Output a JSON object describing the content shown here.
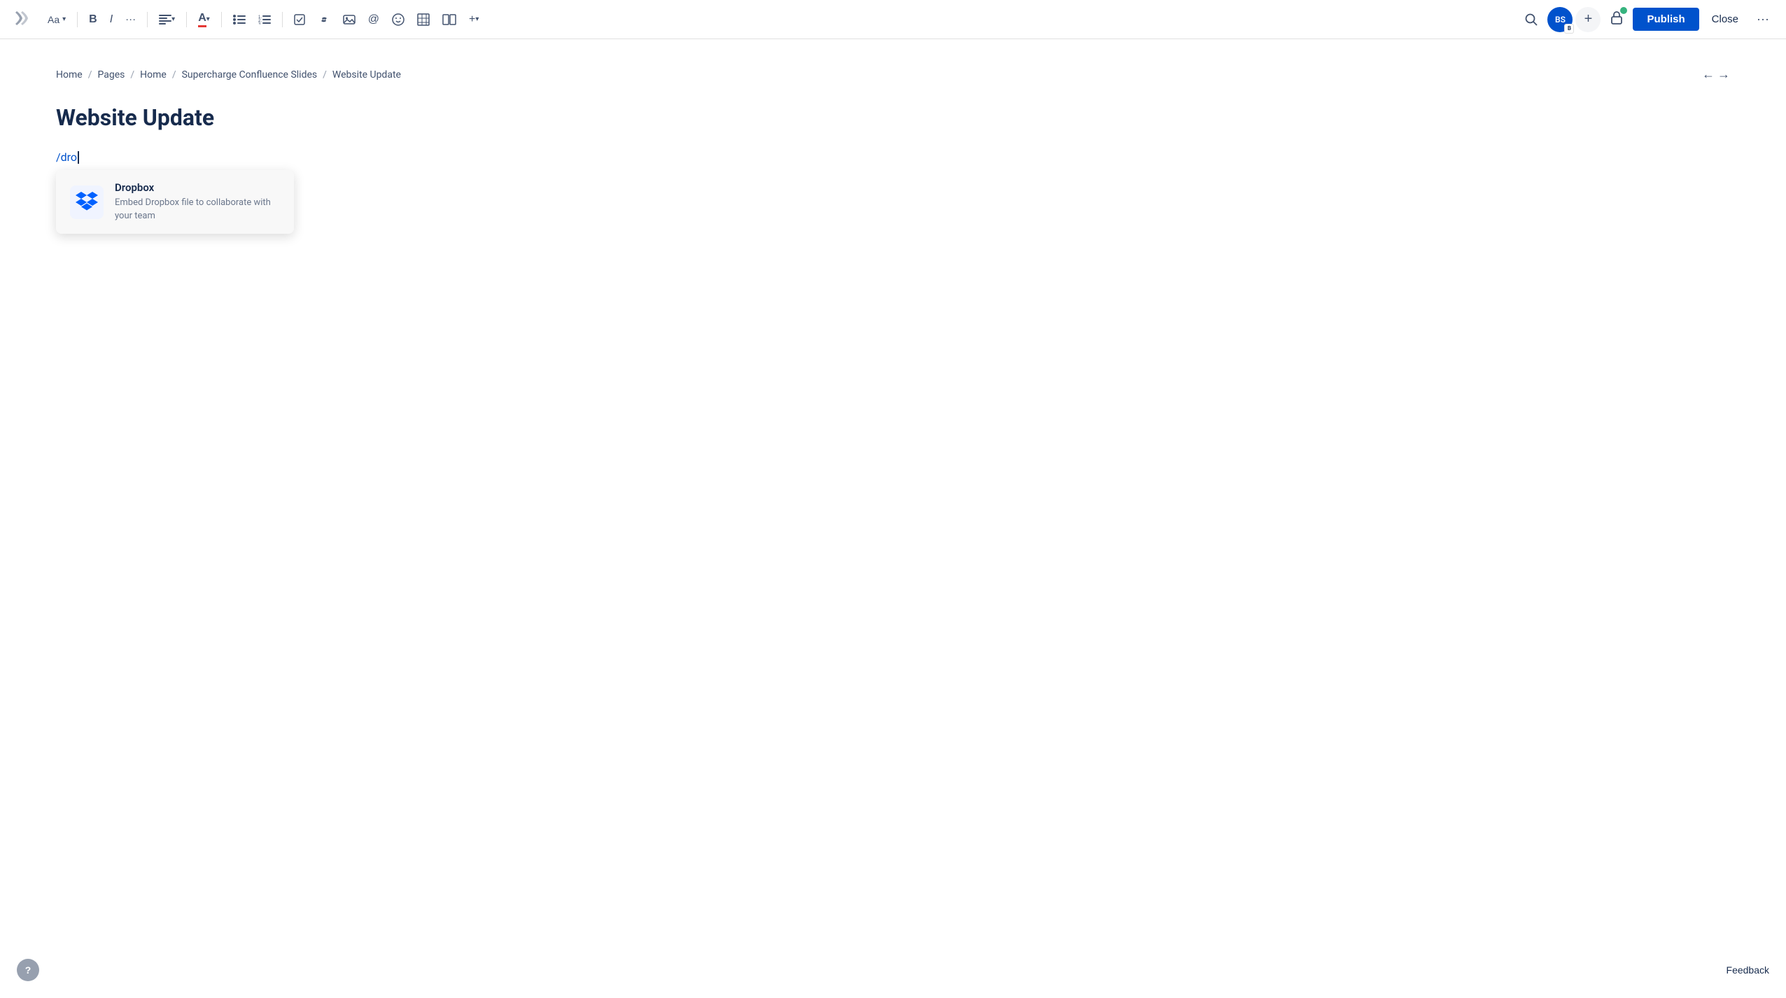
{
  "toolbar": {
    "font_label": "Aa",
    "bold_label": "B",
    "italic_label": "I",
    "more_format_label": "···",
    "align_label": "≡",
    "text_color_label": "A",
    "bullet_list_label": "≡",
    "numbered_list_label": "≡",
    "check_label": "✓",
    "link_label": "🔗",
    "image_label": "🖼",
    "at_label": "@",
    "emoji_label": "☺",
    "table_label": "⊞",
    "layout_label": "⊟",
    "insert_label": "+",
    "search_label": "🔍",
    "avatar_initials": "BS",
    "avatar_badge": "B",
    "add_label": "+",
    "publish_label": "Publish",
    "close_label": "Close",
    "more_label": "···"
  },
  "breadcrumb": {
    "items": [
      "Home",
      "Pages",
      "Home",
      "Supercharge Confluence Slides",
      "Website Update"
    ],
    "separators": [
      "/",
      "/",
      "/",
      "/"
    ]
  },
  "page": {
    "title": "Website Update",
    "slash_command": "/dro"
  },
  "dropdown": {
    "item": {
      "title": "Dropbox",
      "description": "Embed Dropbox file to collaborate with your team"
    }
  },
  "footer": {
    "help_label": "?",
    "feedback_label": "Feedback"
  },
  "colors": {
    "publish_bg": "#0052cc",
    "accent_blue": "#0052cc",
    "slash_color": "#0052cc"
  }
}
